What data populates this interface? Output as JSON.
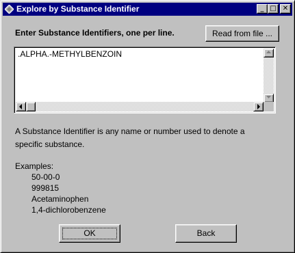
{
  "window": {
    "title": "Explore by Substance Identifier",
    "minimize_glyph": "_",
    "maximize_glyph": "□",
    "close_glyph": "✕"
  },
  "prompt": {
    "label": "Enter Substance Identifiers, one per line.",
    "read_file_button": "Read from file ..."
  },
  "input": {
    "value": ".ALPHA.-METHYLBENZOIN"
  },
  "description": {
    "line1": "A Substance Identifier is any name or number used to denote a",
    "line2": "specific substance."
  },
  "examples": {
    "heading": "Examples:",
    "items": [
      "50-00-0",
      "999815",
      "Acetaminophen",
      "1,4-dichlorobenzene"
    ]
  },
  "buttons": {
    "ok": "OK",
    "back": "Back"
  },
  "colors": {
    "titlebar": "#000080",
    "face": "#c0c0c0"
  }
}
